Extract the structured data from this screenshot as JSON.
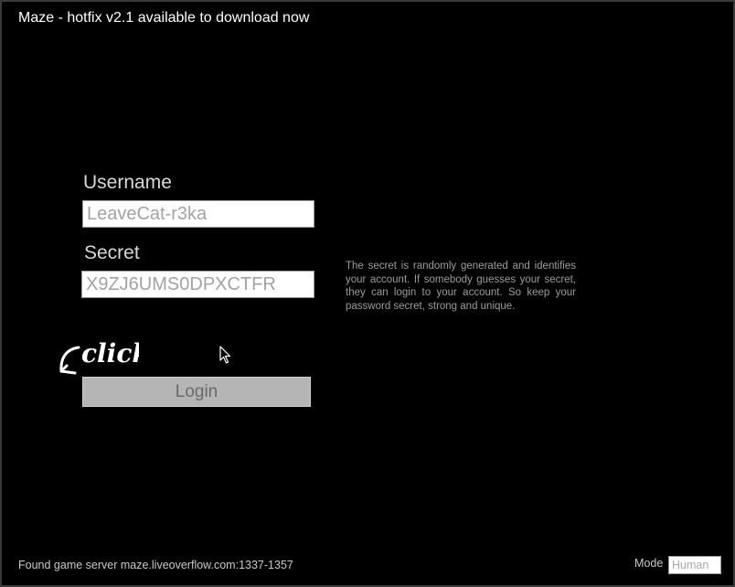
{
  "title": "Maze - hotfix v2.1 available to download now",
  "login_form": {
    "username_label": "Username",
    "username_value": "LeaveCat-r3ka",
    "secret_label": "Secret",
    "secret_value": "X9ZJ6UMS0DPXCTFR",
    "login_label": "Login"
  },
  "info_text": "The secret is randomly generated and identifies your account. If somebody guesses your secret, they can login to your account. So keep your password secret, strong and unique.",
  "hint": {
    "text": "click",
    "icon": "curved-arrow-icon"
  },
  "cursor_icon": "mouse-pointer-icon",
  "status": "Found game server maze.liveoverflow.com:1337-1357",
  "mode": {
    "label": "Mode",
    "value": "Human"
  },
  "colors": {
    "background": "#000000",
    "title_text": "#ffffff",
    "label_text": "#d8d8d8",
    "input_text": "#a3a3a3",
    "button_bg": "#b5b5b5",
    "button_text": "#6a6a6a"
  }
}
